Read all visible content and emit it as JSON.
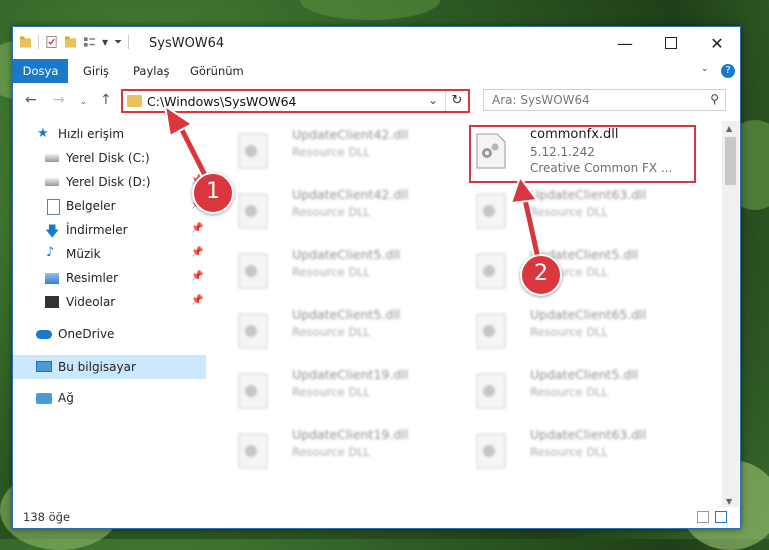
{
  "window": {
    "title": "SysWOW64"
  },
  "ribbon": {
    "tabs": [
      {
        "label": "Dosya",
        "active": true
      },
      {
        "label": "Giriş",
        "active": false
      },
      {
        "label": "Paylaş",
        "active": false
      },
      {
        "label": "Görünüm",
        "active": false
      }
    ]
  },
  "address": {
    "path": "C:\\Windows\\SysWOW64"
  },
  "search": {
    "placeholder": "Ara: SysWOW64"
  },
  "sidebar": {
    "items": [
      {
        "label": "Hızlı erişim",
        "icon": "star-icon"
      },
      {
        "label": "Yerel Disk (C:)",
        "icon": "drive-icon"
      },
      {
        "label": "Yerel Disk (D:)",
        "icon": "drive-icon"
      },
      {
        "label": "Belgeler",
        "icon": "documents-icon"
      },
      {
        "label": "İndirmeler",
        "icon": "download-icon"
      },
      {
        "label": "Müzik",
        "icon": "music-icon"
      },
      {
        "label": "Resimler",
        "icon": "pictures-icon"
      },
      {
        "label": "Videolar",
        "icon": "videos-icon"
      },
      {
        "label": "OneDrive",
        "icon": "cloud-icon"
      },
      {
        "label": "Bu bilgisayar",
        "icon": "computer-icon"
      },
      {
        "label": "Ağ",
        "icon": "network-icon"
      }
    ]
  },
  "files": {
    "col1": [
      {
        "name": "UpdateClient42.dll",
        "desc": "Resource DLL"
      },
      {
        "name": "UpdateClient42.dll",
        "desc": "Resource DLL"
      },
      {
        "name": "UpdateClient5.dll",
        "desc": "Resource DLL"
      },
      {
        "name": "UpdateClient5.dll",
        "desc": "Resource DLL"
      },
      {
        "name": "UpdateClient19.dll",
        "desc": "Resource DLL"
      },
      {
        "name": "UpdateClient19.dll",
        "desc": "Resource DLL"
      }
    ],
    "col2": [
      {
        "name": "UpdateClient63.dll",
        "desc": "Resource DLL"
      },
      {
        "name": "UpdateClient5.dll",
        "desc": "Resource DLL"
      },
      {
        "name": "UpdateClient65.dll",
        "desc": "Resource DLL"
      },
      {
        "name": "UpdateClient5.dll",
        "desc": "Resource DLL"
      },
      {
        "name": "UpdateClient63.dll",
        "desc": "Resource DLL"
      }
    ],
    "highlighted": {
      "name": "commonfx.dll",
      "version": "5.12.1.242",
      "desc": "Creative Common FX ..."
    }
  },
  "status": {
    "count": "138 öğe"
  },
  "annotations": {
    "badge1": "1",
    "badge2": "2",
    "color": "#d9363e"
  }
}
